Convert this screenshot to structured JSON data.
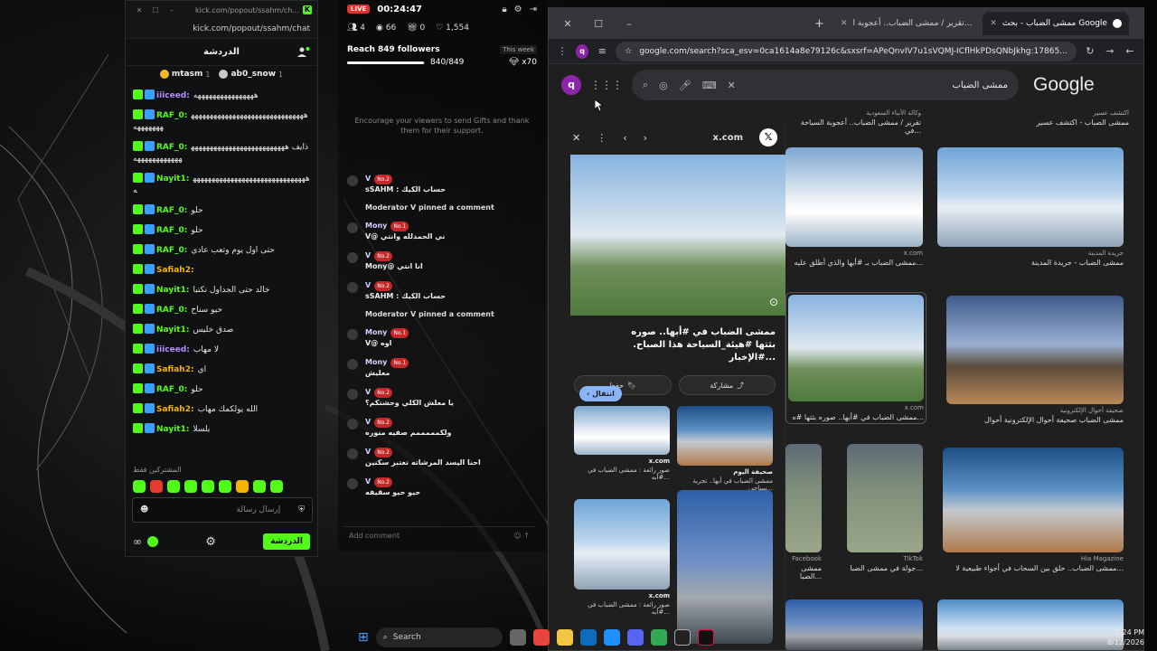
{
  "kick": {
    "title_url": "kick.com/popout/ssahm/ch...",
    "address": "kick.com/popout/ssahm/chat",
    "header": "الدردشة",
    "top_gifters": [
      {
        "rank": "1",
        "name": "mtasm"
      },
      {
        "rank": "1",
        "name": "ab0_snow"
      }
    ],
    "messages": [
      {
        "user": "iiiceed:",
        "text": "ههههههههههههههههه",
        "user_color": "#b48cff"
      },
      {
        "user": "RAF_0:",
        "text": "ههههههههههههههههههههههههههههههههههههههه",
        "user_color": "#53fc18"
      },
      {
        "user": "RAF_0:",
        "text": "ذايف ههههههههههههههههههههههههههههههههههههههه",
        "user_color": "#53fc18"
      },
      {
        "user": "Nayit1:",
        "text": "هههههههههههههههههههههههههههههههه",
        "user_color": "#53fc18"
      },
      {
        "user": "RAF_0:",
        "text": "حلو",
        "user_color": "#53fc18"
      },
      {
        "user": "RAF_0:",
        "text": "حلو",
        "user_color": "#53fc18"
      },
      {
        "user": "RAF_0:",
        "text": "حتى اول يوم وتعب عادي",
        "user_color": "#53fc18"
      },
      {
        "user": "Safiah2:",
        "text": "",
        "user_color": "#f4b400"
      },
      {
        "user": "Nayit1:",
        "text": "خالد حتى الجداول نكتبا",
        "user_color": "#53fc18"
      },
      {
        "user": "RAF_0:",
        "text": "حيو سناح",
        "user_color": "#53fc18"
      },
      {
        "user": "Nayit1:",
        "text": "صدق خليس",
        "user_color": "#53fc18"
      },
      {
        "user": "iiiceed:",
        "text": "لا مهاب",
        "user_color": "#b48cff"
      },
      {
        "user": "Safiah2:",
        "text": "اي",
        "user_color": "#f4b400"
      },
      {
        "user": "RAF_0:",
        "text": "حلو",
        "user_color": "#53fc18"
      },
      {
        "user": "Safiah2:",
        "text": "الله يولكمك مهاب",
        "user_color": "#f4b400"
      },
      {
        "user": "Nayit1:",
        "text": "يلسلا",
        "user_color": "#53fc18"
      }
    ],
    "subs_only_label": "المشتركين فقط",
    "input_placeholder": "إرسال رسالة",
    "send_label": "الدردشة"
  },
  "overlay": {
    "live": "LIVE",
    "time": "00:24:47",
    "stats": {
      "viewers": "4",
      "followers_count": "66",
      "gifts": "0",
      "likes": "1,554"
    },
    "goal_title": "Reach 849 followers",
    "goal_week": "This week",
    "goal_progress": 0.989,
    "goal_count": "840/849",
    "goal_mult": "x70",
    "encourage": "Encourage your viewers to send Gifts and thank them for their support.",
    "events": [
      {
        "name": "V",
        "no": "No.2",
        "text": "sSAHM : حساب الكيك",
        "type": "msg"
      },
      {
        "pin": "Moderator V pinned a comment",
        "type": "pin"
      },
      {
        "name": "Mony",
        "no": "No.1",
        "text": "V@ ني الحمدلله وانتي",
        "type": "msg"
      },
      {
        "name": "V",
        "no": "No.2",
        "text": "Mony@ انا انتي",
        "type": "msg"
      },
      {
        "name": "V",
        "no": "No.2",
        "text": "sSAHM : حساب الكيك",
        "type": "msg"
      },
      {
        "pin": "Moderator V pinned a comment",
        "type": "pin"
      },
      {
        "name": "Mony",
        "no": "No.1",
        "text": "V@ اوه",
        "type": "msg"
      },
      {
        "name": "Mony",
        "no": "No.1",
        "text": "معليش",
        "type": "msg"
      },
      {
        "name": "V",
        "no": "No.2",
        "text": "يا معلش الكلي وحشتكم؟",
        "type": "msg"
      },
      {
        "name": "V",
        "no": "No.2",
        "text": "ولكمممممم صفيه منوره",
        "type": "msg"
      },
      {
        "name": "V",
        "no": "No.2",
        "text": "احنا اليسد المرشاته تعتبر سكنين",
        "type": "msg"
      },
      {
        "name": "V",
        "no": "No.2",
        "text": "حيو حيو سقيفه",
        "type": "msg"
      }
    ],
    "comment_placeholder": "Add comment"
  },
  "chrome": {
    "tabs": [
      {
        "label": "ممشى الضباب - بحث Google",
        "active": true
      },
      {
        "label": "تقرير / ممشى الضباب.. أعجوبة ا...",
        "active": false
      }
    ],
    "url": "google.com/search?sca_esv=0ca1614a8e79126c&sxsrf=APeQnvIV7u1sVQMJ-ICflHkPDsQNbJkhg:17865...",
    "profile_letter": "q"
  },
  "google": {
    "logo": "Google",
    "query": "ممشى الضباب",
    "avatar_letter": "q",
    "panel": {
      "source": "x.com",
      "caption": "ممشى الضباب في #أبها.. صوره بثتها #هيئة_السياحة هذا الصباح. #الإخبار...",
      "visit": "انتقال",
      "share": "مشاركة",
      "save": "حفظ",
      "related": [
        {
          "source": "x.com",
          "title": "صور رائعة : ممشى الضباب في #أبه..."
        },
        {
          "source": "صحيفة اليوم",
          "title": "ممشى الضباب في أبها.. تجربة سياحي..."
        },
        {
          "source": "x.com",
          "title": "صور رائعة : ممشى الضباب في #أبه..."
        },
        {
          "source": "",
          "title": ""
        }
      ]
    },
    "results": [
      {
        "source": "اكتشف عسير",
        "title": "ممشى الضباب - اكتشف عسير"
      },
      {
        "source": "وكالة الأنباء السعودية",
        "title": "تقرير / ممشى الضباب.. أعجوبة السياحة في..."
      },
      {
        "source": "x.com",
        "title": "ممشى الضباب بـ #أبها والذي أطلق عليه..."
      },
      {
        "source": "جريدة المدينة",
        "title": "ممشى الضباب - جريدة المدينة"
      },
      {
        "source": "x.com",
        "title": "ممشى الضباب في #أبها.. صوره بثتها #ه..."
      },
      {
        "source": "صحيفة أحوال الإلكترونية",
        "title": "ممشى الضباب صحيفة أحوال الإلكترونية أحوال"
      },
      {
        "source": "Facebook",
        "title": "ممشى الضبا..."
      },
      {
        "source": "TikTok",
        "title": "جولة في ممشى الضبا..."
      },
      {
        "source": "Hia Magazine",
        "title": "ممشى الضباب.. حلق بين السحاب في أجواء طبيعية لا..."
      }
    ]
  },
  "taskbar": {
    "search": "Search",
    "time": "2:24 PM",
    "date": "8/12/2026"
  }
}
